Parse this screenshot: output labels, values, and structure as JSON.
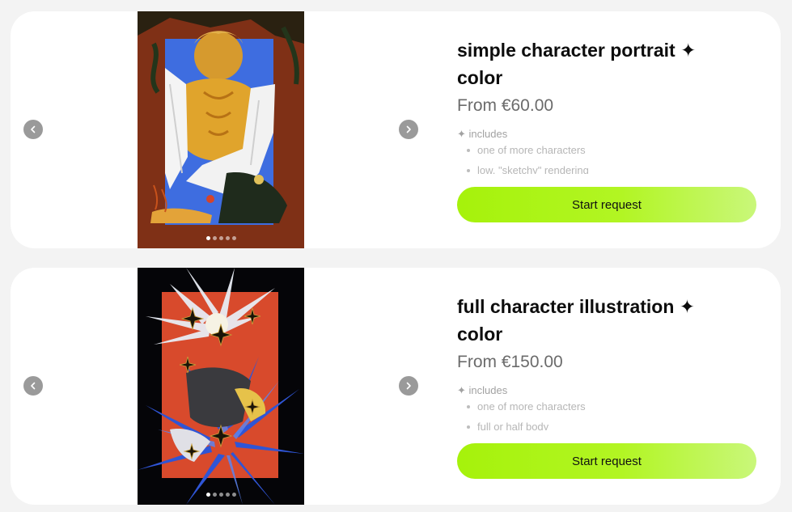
{
  "colors": {
    "page_bg": "#f3f3f3",
    "card_bg": "#ffffff",
    "cta_start": "#a6f20b",
    "cta_end": "#c9f77a",
    "arrow_bg": "#9a9a9a"
  },
  "products": [
    {
      "title": "simple character portrait ✦ color",
      "price": "From €60.00",
      "includes_label": "✦ includes",
      "features": [
        "one of more characters",
        "low, \"sketchy\" rendering"
      ],
      "cta_label": "Start request",
      "gallery": {
        "slides": 5,
        "active_slide": 1,
        "prev_icon": "chevron-left-icon",
        "next_icon": "chevron-right-icon"
      }
    },
    {
      "title": "full character illustration ✦ color",
      "price": "From €150.00",
      "includes_label": "✦ includes",
      "features": [
        "one of more characters",
        "full or half body"
      ],
      "cta_label": "Start request",
      "gallery": {
        "slides": 5,
        "active_slide": 1,
        "prev_icon": "chevron-left-icon",
        "next_icon": "chevron-right-icon"
      }
    }
  ]
}
